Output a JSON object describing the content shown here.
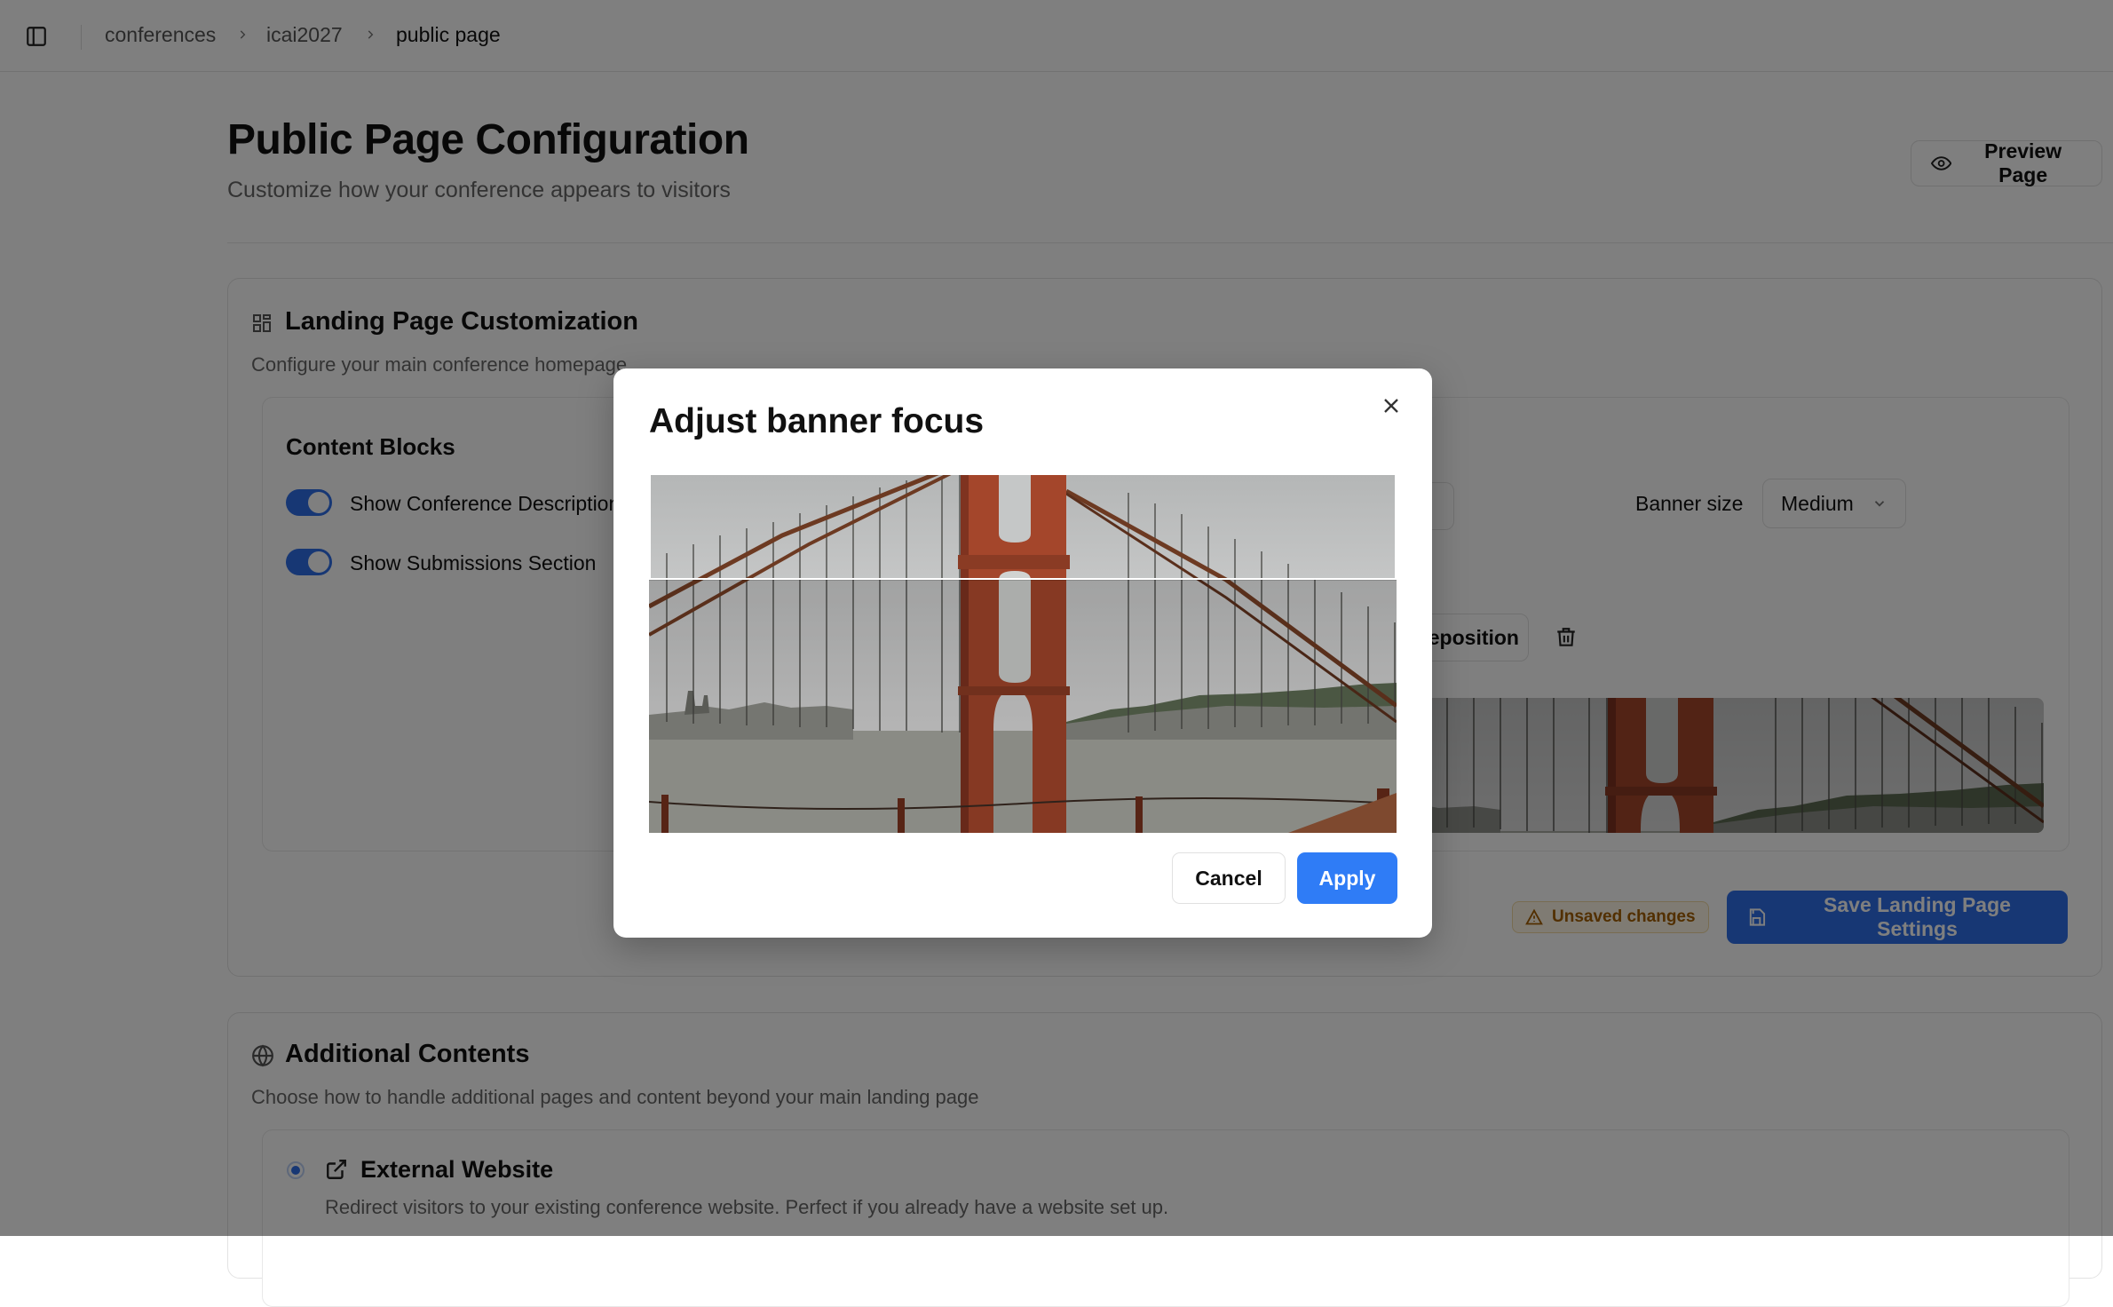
{
  "breadcrumb": [
    "conferences",
    "icai2027",
    "public page"
  ],
  "header": {
    "title": "Public Page Configuration",
    "subtitle": "Customize how your conference appears to visitors",
    "preview_label": "Preview Page"
  },
  "landing": {
    "title": "Landing Page Customization",
    "description": "Configure your main conference homepage",
    "blocks_title": "Content Blocks",
    "toggles": [
      {
        "label": "Show Conference Description",
        "on": true
      },
      {
        "label": "Show Submissions Section",
        "on": true
      }
    ],
    "banner_size_label": "Banner size",
    "banner_size_value": "Medium",
    "reposition_label": "Reposition",
    "unsaved_label": "Unsaved changes",
    "save_label": "Save Landing Page Settings"
  },
  "additional": {
    "title": "Additional Contents",
    "description": "Choose how to handle additional pages and content beyond your main landing page",
    "option_title": "External Website",
    "option_description": "Redirect visitors to your existing conference website. Perfect if you already have a website set up."
  },
  "modal": {
    "title": "Adjust banner focus",
    "cancel_label": "Cancel",
    "apply_label": "Apply"
  },
  "colors": {
    "accent": "#2f6fe8",
    "apply": "#2f7cf6",
    "warning_text": "#a45f00",
    "bridge": "#a4462b",
    "sky": "#c9c9c9",
    "water": "#a9aaa3"
  },
  "icons": [
    "sidebar-toggle-icon",
    "chevron-right-icon",
    "eye-icon",
    "layout-grid-icon",
    "chevron-down-icon",
    "trash-icon",
    "alert-triangle-icon",
    "save-icon",
    "globe-icon",
    "external-link-icon",
    "close-icon"
  ]
}
